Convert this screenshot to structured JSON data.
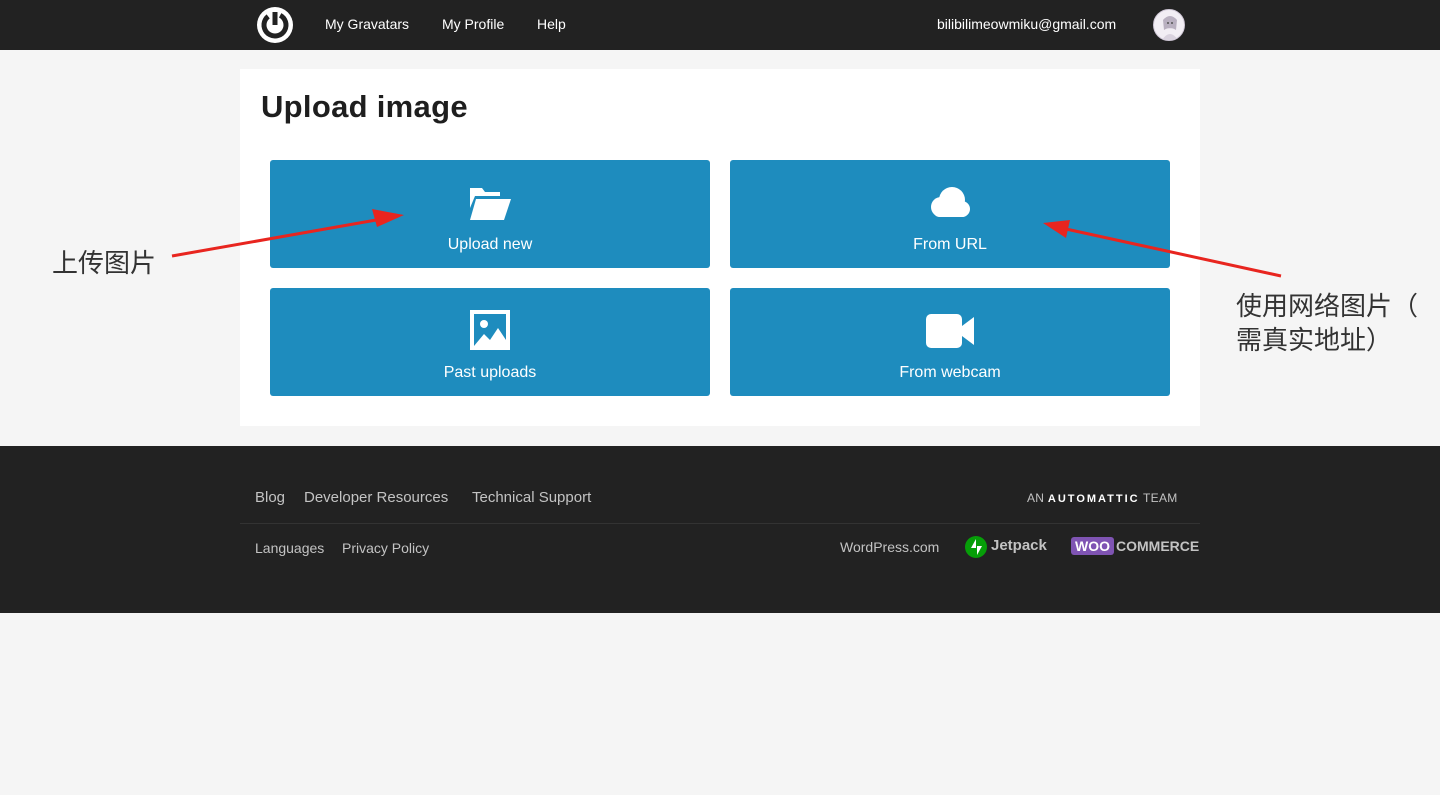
{
  "header": {
    "logo_icon": "gravatar-logo-icon",
    "nav": [
      {
        "label": "My Gravatars"
      },
      {
        "label": "My Profile"
      },
      {
        "label": "Help"
      }
    ],
    "user_email": "bilibilimeowmiku@gmail.com",
    "avatar_icon": "user-avatar"
  },
  "main": {
    "title": "Upload image",
    "options": [
      {
        "label": "Upload new",
        "icon": "folder-open-icon"
      },
      {
        "label": "From URL",
        "icon": "cloud-icon"
      },
      {
        "label": "Past uploads",
        "icon": "image-icon"
      },
      {
        "label": "From webcam",
        "icon": "video-camera-icon"
      }
    ],
    "accent_color": "#1e8cbe"
  },
  "annotations": {
    "left": "上传图片",
    "right_line1": "使用网络图片（",
    "right_line2": "需真实地址）",
    "arrow_color": "#e8251f"
  },
  "footer": {
    "links_row1": [
      "Blog",
      "Developer Resources",
      "Technical Support"
    ],
    "links_row2": [
      "Languages",
      "Privacy Policy"
    ],
    "team_prefix": "AN",
    "team_brand": "AUTOMATTIC",
    "team_suffix": "TEAM",
    "products": {
      "wordpress": "WordPress.com",
      "jetpack": "Jetpack",
      "woo_badge": "WOO",
      "woo_text": "COMMERCE"
    }
  }
}
